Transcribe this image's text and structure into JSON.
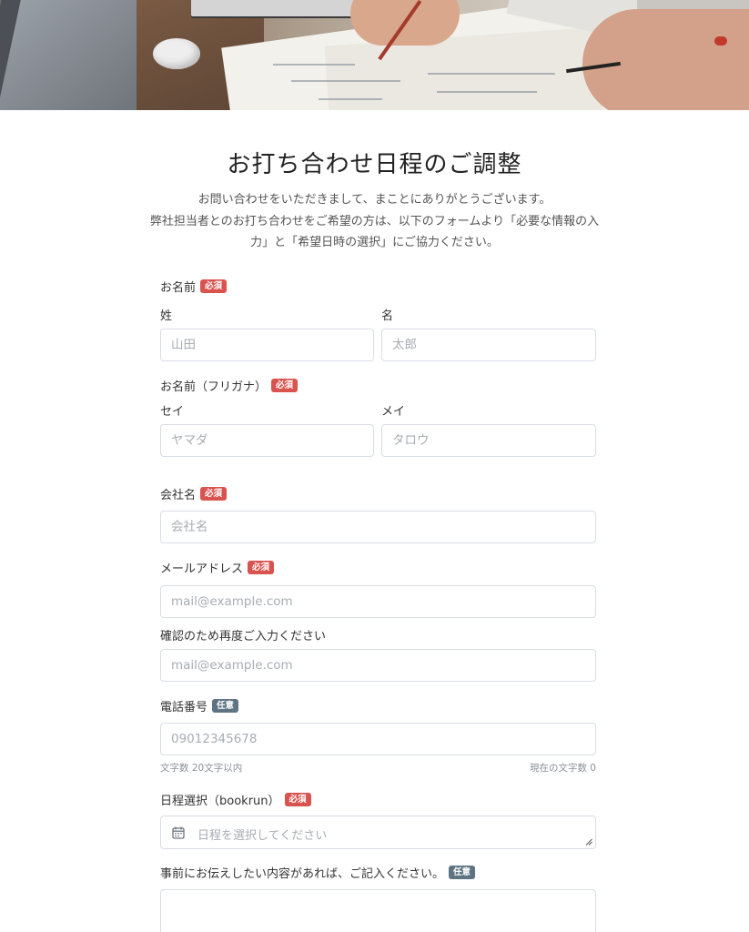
{
  "page": {
    "title": "お打ち合わせ日程のご調整",
    "intro_line1": "お問い合わせをいただきまして、まことにありがとうございます。",
    "intro_line2": "弊社担当者とのお打ち合わせをご希望の方は、以下のフォームより「必要な情報の入",
    "intro_line3": "力」と「希望日時の選択」にご協力ください。"
  },
  "badges": {
    "required": "必須",
    "optional": "任意"
  },
  "form": {
    "name": {
      "label": "お名前",
      "last_label": "姓",
      "last_placeholder": "山田",
      "first_label": "名",
      "first_placeholder": "太郎"
    },
    "kana": {
      "label": "お名前（フリガナ）",
      "last_label": "セイ",
      "last_placeholder": "ヤマダ",
      "first_label": "メイ",
      "first_placeholder": "タロウ"
    },
    "company": {
      "label": "会社名",
      "placeholder": "会社名"
    },
    "email": {
      "label": "メールアドレス",
      "placeholder": "mail@example.com"
    },
    "email_confirm": {
      "label": "確認のため再度ご入力ください",
      "placeholder": "mail@example.com"
    },
    "phone": {
      "label": "電話番号",
      "placeholder": "09012345678",
      "helper_left": "文字数 20文字以内",
      "helper_right": "現在の文字数 0"
    },
    "schedule": {
      "label": "日程選択（bookrun）",
      "placeholder": "日程を選択してください",
      "icon": "calendar-icon"
    },
    "message": {
      "label": "事前にお伝えしたい内容があれば、ご記入ください。"
    }
  }
}
